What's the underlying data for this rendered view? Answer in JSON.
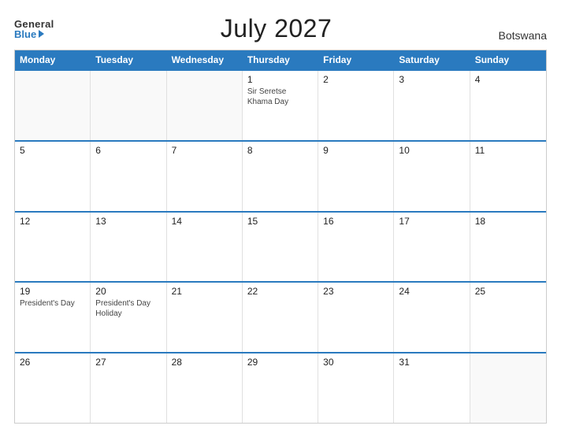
{
  "header": {
    "logo_general": "General",
    "logo_blue": "Blue",
    "title": "July 2027",
    "country": "Botswana"
  },
  "calendar": {
    "days": [
      "Monday",
      "Tuesday",
      "Wednesday",
      "Thursday",
      "Friday",
      "Saturday",
      "Sunday"
    ],
    "weeks": [
      [
        {
          "num": "",
          "event": "",
          "empty": true
        },
        {
          "num": "",
          "event": "",
          "empty": true
        },
        {
          "num": "",
          "event": "",
          "empty": true
        },
        {
          "num": "1",
          "event": "Sir Seretse Khama Day",
          "empty": false
        },
        {
          "num": "2",
          "event": "",
          "empty": false
        },
        {
          "num": "3",
          "event": "",
          "empty": false
        },
        {
          "num": "4",
          "event": "",
          "empty": false
        }
      ],
      [
        {
          "num": "5",
          "event": "",
          "empty": false
        },
        {
          "num": "6",
          "event": "",
          "empty": false
        },
        {
          "num": "7",
          "event": "",
          "empty": false
        },
        {
          "num": "8",
          "event": "",
          "empty": false
        },
        {
          "num": "9",
          "event": "",
          "empty": false
        },
        {
          "num": "10",
          "event": "",
          "empty": false
        },
        {
          "num": "11",
          "event": "",
          "empty": false
        }
      ],
      [
        {
          "num": "12",
          "event": "",
          "empty": false
        },
        {
          "num": "13",
          "event": "",
          "empty": false
        },
        {
          "num": "14",
          "event": "",
          "empty": false
        },
        {
          "num": "15",
          "event": "",
          "empty": false
        },
        {
          "num": "16",
          "event": "",
          "empty": false
        },
        {
          "num": "17",
          "event": "",
          "empty": false
        },
        {
          "num": "18",
          "event": "",
          "empty": false
        }
      ],
      [
        {
          "num": "19",
          "event": "President's Day",
          "empty": false
        },
        {
          "num": "20",
          "event": "President's Day Holiday",
          "empty": false
        },
        {
          "num": "21",
          "event": "",
          "empty": false
        },
        {
          "num": "22",
          "event": "",
          "empty": false
        },
        {
          "num": "23",
          "event": "",
          "empty": false
        },
        {
          "num": "24",
          "event": "",
          "empty": false
        },
        {
          "num": "25",
          "event": "",
          "empty": false
        }
      ],
      [
        {
          "num": "26",
          "event": "",
          "empty": false
        },
        {
          "num": "27",
          "event": "",
          "empty": false
        },
        {
          "num": "28",
          "event": "",
          "empty": false
        },
        {
          "num": "29",
          "event": "",
          "empty": false
        },
        {
          "num": "30",
          "event": "",
          "empty": false
        },
        {
          "num": "31",
          "event": "",
          "empty": false
        },
        {
          "num": "",
          "event": "",
          "empty": true
        }
      ]
    ]
  }
}
